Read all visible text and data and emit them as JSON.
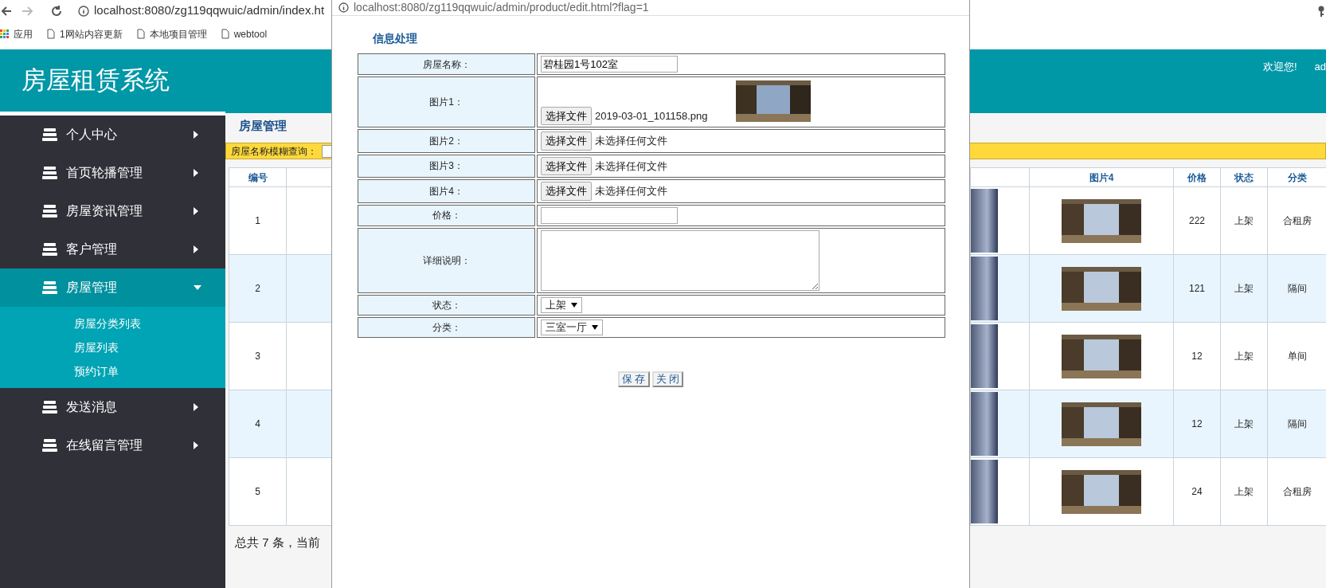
{
  "browser": {
    "address": "localhost:8080/zg119qqwuic/admin/index.ht",
    "bookmarks": [
      {
        "kind": "apps",
        "label": "应用"
      },
      {
        "kind": "page",
        "label": "1网站内容更新"
      },
      {
        "kind": "page",
        "label": "本地项目管理"
      },
      {
        "kind": "page",
        "label": "webtool"
      }
    ]
  },
  "header": {
    "title": "房屋租赁系统",
    "welcome": "欢迎您!",
    "user": "ad"
  },
  "sidebar": {
    "items": [
      {
        "label": "个人中心",
        "expanded": false
      },
      {
        "label": "首页轮播管理",
        "expanded": false
      },
      {
        "label": "房屋资讯管理",
        "expanded": false
      },
      {
        "label": "客户管理",
        "expanded": false
      },
      {
        "label": "房屋管理",
        "expanded": true,
        "children": [
          {
            "label": "房屋分类列表"
          },
          {
            "label": "房屋列表"
          },
          {
            "label": "预约订单"
          }
        ]
      },
      {
        "label": "发送消息",
        "expanded": false
      },
      {
        "label": "在线留言管理",
        "expanded": false
      }
    ]
  },
  "content": {
    "title": "房屋管理",
    "search_label": "房屋名称模糊查询：",
    "table": {
      "columns": [
        {
          "kind": "text",
          "label": "编号"
        },
        {
          "kind": "blank"
        },
        {
          "kind": "partial_photo"
        },
        {
          "kind": "photo",
          "label": "图片4"
        },
        {
          "kind": "text",
          "label": "价格"
        },
        {
          "kind": "text",
          "label": "状态"
        },
        {
          "kind": "text",
          "label": "分类"
        }
      ],
      "rows": [
        {
          "cells": [
            "1",
            "222",
            "上架",
            "合租房"
          ]
        },
        {
          "cells": [
            "2",
            "121",
            "上架",
            "隔间"
          ]
        },
        {
          "cells": [
            "3",
            "12",
            "上架",
            "单间"
          ]
        },
        {
          "cells": [
            "4",
            "12",
            "上架",
            "隔间"
          ]
        },
        {
          "cells": [
            "5",
            "24",
            "上架",
            "合租房"
          ]
        }
      ]
    },
    "footer": "总共 7 条，当前"
  },
  "popup": {
    "address": "localhost:8080/zg119qqwuic/admin/product/edit.html?flag=1",
    "title": "信息处理",
    "fields": [
      {
        "kind": "text",
        "label": "房屋名称：",
        "value": "碧桂园1号102室"
      },
      {
        "kind": "file",
        "label": "图片1：",
        "button": "选择文件",
        "file": "2019-03-01_101158.png",
        "preview": true
      },
      {
        "kind": "file",
        "label": "图片2：",
        "button": "选择文件",
        "file": "未选择任何文件",
        "preview": false
      },
      {
        "kind": "file",
        "label": "图片3：",
        "button": "选择文件",
        "file": "未选择任何文件",
        "preview": false
      },
      {
        "kind": "file",
        "label": "图片4：",
        "button": "选择文件",
        "file": "未选择任何文件",
        "preview": false
      },
      {
        "kind": "text",
        "label": "价格："
      },
      {
        "kind": "textarea",
        "label": "详细说明："
      },
      {
        "kind": "select",
        "label": "状态：",
        "value": "上架"
      },
      {
        "kind": "select",
        "label": "分类：",
        "value": "三室一厅"
      }
    ],
    "buttons": [
      "保 存",
      "关 闭"
    ]
  }
}
